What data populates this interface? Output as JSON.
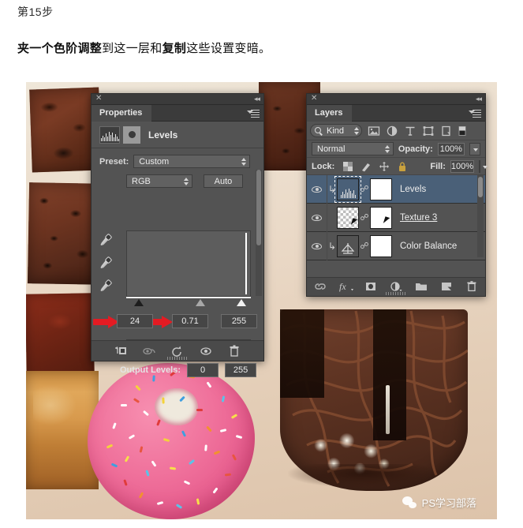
{
  "article": {
    "step_label": "第15步",
    "description_bold_1": "夹一个",
    "description_bold_2": "色阶调整",
    "description_norm_1": "到这一层和",
    "description_bold_3": "复制",
    "description_norm_2": "这些设置变暗。",
    "description_full": "夹一个色阶调整到这一层和复制这些设置变暗。"
  },
  "properties_panel": {
    "tab_title": "Properties",
    "adjustment_title": "Levels",
    "preset_label": "Preset:",
    "preset_value": "Custom",
    "channel_value": "RGB",
    "auto_label": "Auto",
    "input_shadow": "24",
    "input_midtone": "0.71",
    "input_highlight": "255",
    "output_label": "Output Levels:",
    "output_black": "0",
    "output_white": "255",
    "annotation_color": "#e31b23",
    "footer_icons": [
      "clip-to-layer-icon",
      "view-previous-state-icon",
      "reset-icon",
      "toggle-visibility-icon",
      "delete-icon"
    ],
    "eyedroppers": [
      "black-point-eyedropper",
      "gray-point-eyedropper",
      "white-point-eyedropper"
    ]
  },
  "layers_panel": {
    "tab_title": "Layers",
    "filter_kind_label": "Kind",
    "filter_icons": [
      "filter-pixel-icon",
      "filter-adjustment-icon",
      "filter-type-icon",
      "filter-shape-icon",
      "filter-smart-object-icon"
    ],
    "blend_mode": "Normal",
    "opacity_label": "Opacity:",
    "opacity_value": "100%",
    "lock_label": "Lock:",
    "lock_icons": [
      "lock-transparent-pixels-icon",
      "lock-image-pixels-icon",
      "lock-position-icon",
      "lock-all-icon"
    ],
    "fill_label": "Fill:",
    "fill_value": "100%",
    "layers": [
      {
        "name": "Levels",
        "selected": true,
        "underline": false,
        "thumb": "adjustment",
        "clipped": true,
        "linked": true,
        "visible": true
      },
      {
        "name": "Texture 3",
        "selected": false,
        "underline": true,
        "thumb": "checker",
        "clipped": false,
        "linked": true,
        "visible": true
      },
      {
        "name": "Color Balance",
        "selected": false,
        "underline": false,
        "thumb": "adjustment",
        "clipped": true,
        "linked": true,
        "visible": true
      }
    ],
    "footer_icons": [
      "link-layers-icon",
      "layer-style-fx-icon",
      "add-layer-mask-icon",
      "new-adjustment-layer-icon",
      "new-group-icon",
      "new-layer-icon",
      "delete-layer-icon"
    ]
  },
  "canvas": {
    "background_color": "#e9d8c6",
    "items": [
      "chocolate-texture-shard-top-left",
      "chocolate-texture-shard-mid-left",
      "red-chocolate-shard",
      "golden-cake-slice",
      "chocolate-texture-shard-top-right",
      "pink-frosted-donut-with-sprinkles",
      "chocolate-drizzle-piece-with-coconut-filling"
    ]
  },
  "watermark": {
    "text": "PS学习部落",
    "icon": "wechat-icon"
  }
}
